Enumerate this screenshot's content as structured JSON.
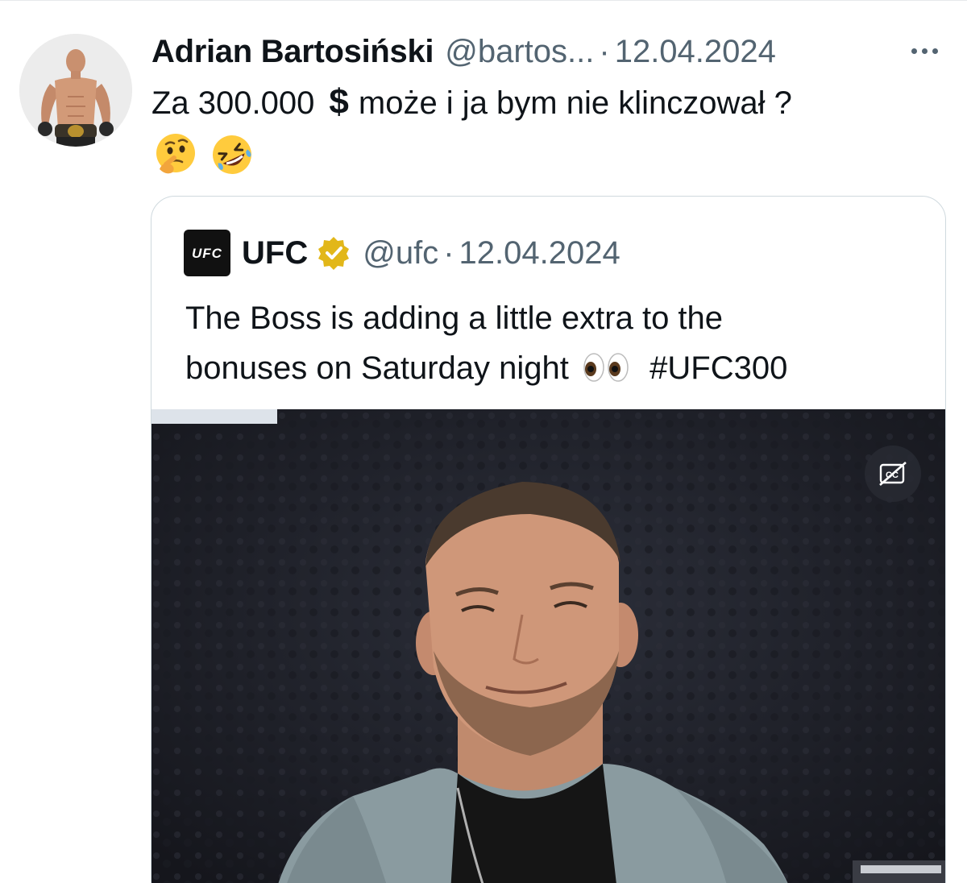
{
  "tweet": {
    "author": {
      "display_name": "Adrian Bartosiński",
      "handle": "@bartos...",
      "separator": "·",
      "date": "12.04.2024"
    },
    "text": "Za 300.000",
    "money_icon": "$",
    "text_after": "może i ja bym nie klinczował ?",
    "emojis": [
      "thinking-face",
      "rolling-on-the-floor-laughing"
    ]
  },
  "quote": {
    "author": {
      "display_name": "UFC",
      "handle": "@ufc",
      "separator": "·",
      "date": "12.04.2024",
      "logo_text": "UFC",
      "verified": true
    },
    "text_line1": "The Boss is adding a little extra to the",
    "text_line2_before": "bonuses on Saturday night",
    "text_line2_emoji": "eyes",
    "hashtag": "#UFC300",
    "media": {
      "type": "video",
      "cc_icon": "closed-captions-off-icon"
    }
  },
  "colors": {
    "text_primary": "#0f1419",
    "text_secondary": "#536471",
    "border": "#cfd9de",
    "verified_gold": "#e2b719"
  }
}
